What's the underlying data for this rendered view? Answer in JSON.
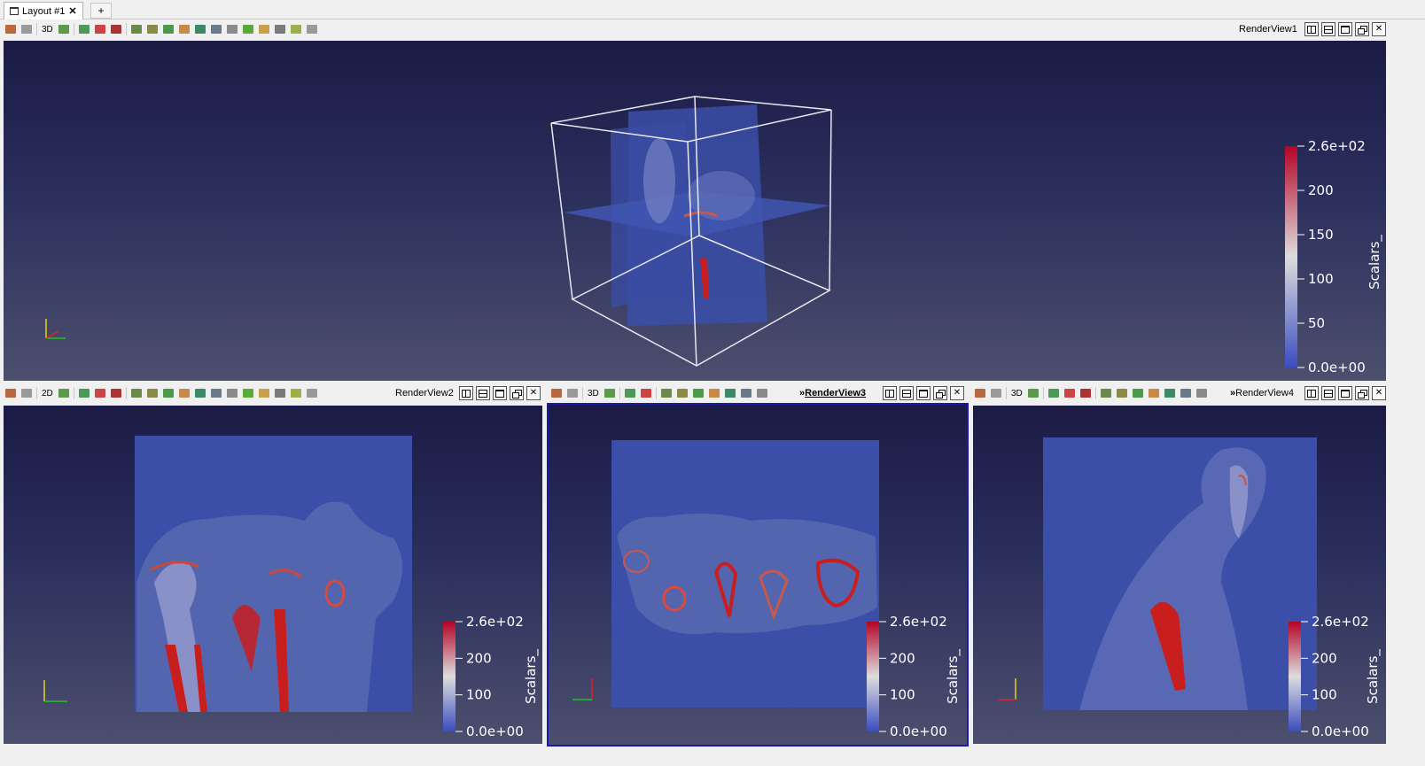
{
  "layout_tab": {
    "label": "Layout #1",
    "close_glyph": "✕",
    "add_glyph": "+"
  },
  "views": {
    "top": {
      "name": "RenderView1",
      "mode": "3D",
      "colorbar": {
        "title": "Scalars_",
        "labels": [
          "2.6e+02",
          "200",
          "150",
          "100",
          "50",
          "0.0e+00"
        ]
      }
    },
    "bottom_left": {
      "name": "RenderView2",
      "mode": "2D",
      "colorbar": {
        "title": "Scalars_",
        "labels": [
          "2.6e+02",
          "200",
          "100",
          "0.0e+00"
        ]
      }
    },
    "bottom_middle": {
      "name": "RenderView3",
      "prefix": "»",
      "mode": "3D",
      "active": true,
      "colorbar": {
        "title": "Scalars_",
        "labels": [
          "2.6e+02",
          "200",
          "100",
          "0.0e+00"
        ]
      }
    },
    "bottom_right": {
      "name": "RenderView4",
      "prefix": "»",
      "mode": "3D",
      "colorbar": {
        "title": "Scalars_",
        "labels": [
          "2.6e+02",
          "200",
          "100",
          "0.0e+00"
        ]
      }
    }
  },
  "view_controls": {
    "split_horizontal": "split-horizontal-icon",
    "split_vertical": "split-vertical-icon",
    "maximize": "maximize-icon",
    "restore": "restore-icon",
    "close": "✕"
  },
  "colors": {
    "volume_blue": "#3b4fa8",
    "bone_red": "#c81e1e",
    "background_top": "#1b1b45",
    "background_bottom": "#4c4f6e",
    "active_border": "#1a1aa6"
  }
}
